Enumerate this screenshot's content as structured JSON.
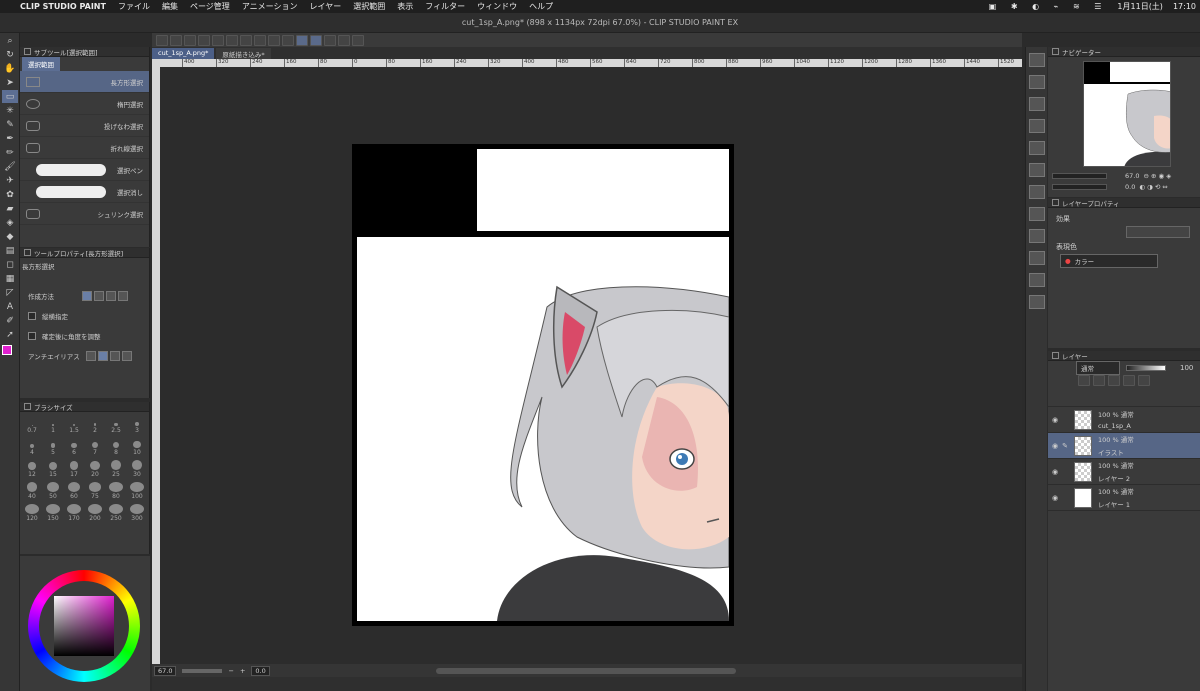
{
  "menubar": {
    "apple": "",
    "app": "CLIP STUDIO PAINT",
    "items": [
      "ファイル",
      "編集",
      "ページ管理",
      "アニメーション",
      "レイヤー",
      "選択範囲",
      "表示",
      "フィルター",
      "ウィンドウ",
      "ヘルプ"
    ],
    "date": "1月11日(土)",
    "time": "17:10"
  },
  "window": {
    "title": "cut_1sp_A.png* (898 x 1134px 72dpi 67.0%)  - CLIP STUDIO PAINT EX"
  },
  "doc_tabs": [
    "cut_1sp_A.png*",
    "原紙描き込み*"
  ],
  "subtool": {
    "header": "サブツール[選択範囲]",
    "tab": "選択範囲",
    "items": [
      "長方形選択",
      "楕円選択",
      "投げなわ選択",
      "折れ線選択",
      "選択ペン",
      "選択消し",
      "シュリンク選択"
    ]
  },
  "toolprop": {
    "header": "ツールプロパティ[長方形選択]",
    "name": "長方形選択",
    "mode_label": "作成方法",
    "aspect_label": "縦横指定",
    "angle_label": "確定後に角度を調整",
    "aa_label": "アンチエイリアス"
  },
  "brushsize": {
    "header": "ブラシサイズ",
    "sizes": [
      "0.7",
      "1",
      "1.5",
      "2",
      "2.5",
      "3",
      "4",
      "5",
      "6",
      "7",
      "8",
      "10",
      "12",
      "15",
      "17",
      "20",
      "25",
      "30",
      "40",
      "50",
      "60",
      "75",
      "80",
      "100",
      "120",
      "150",
      "170",
      "200",
      "250",
      "300"
    ]
  },
  "ruler": {
    "ticks": [
      "400",
      "320",
      "240",
      "160",
      "80",
      "0",
      "80",
      "160",
      "240",
      "320",
      "400",
      "480",
      "560",
      "640",
      "720",
      "800",
      "880",
      "960",
      "1040",
      "1120",
      "1200",
      "1280",
      "1360",
      "1440",
      "1520"
    ]
  },
  "status": {
    "zoom": "67.0",
    "angle": "0.0"
  },
  "navigator": {
    "header": "ナビゲーター",
    "zoom": "67.0",
    "rotate": "0.0"
  },
  "layerprop": {
    "header": "レイヤープロパティ",
    "effect_label": "効果",
    "color_label": "表現色",
    "color_value": "カラー"
  },
  "layers": {
    "header": "レイヤー",
    "blend": "通常",
    "opacity": "100",
    "rows": [
      {
        "meta": "100 % 通常",
        "name": "cut_1sp_A",
        "selected": false
      },
      {
        "meta": "100 % 通常",
        "name": "イラスト",
        "selected": true
      },
      {
        "meta": "100 % 通常",
        "name": "レイヤー 2",
        "selected": false
      },
      {
        "meta": "100 % 通常",
        "name": "レイヤー 1",
        "selected": false
      }
    ]
  },
  "colors": {
    "accent": "#566686",
    "main_color": "#e020d0",
    "sub_color": "#ffffff"
  }
}
